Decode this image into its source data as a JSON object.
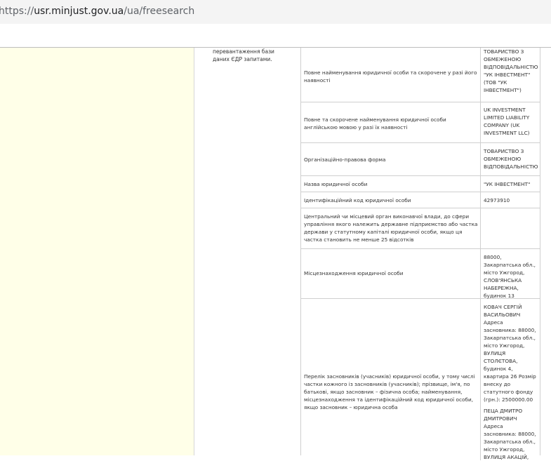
{
  "browser": {
    "url_scheme": "https://",
    "url_host": "usr.minjust.gov.ua",
    "url_path": "/ua/freesearch"
  },
  "note": {
    "text": "перевантаження бази даних ЄДР запитами."
  },
  "rows": [
    {
      "label": "Повне найменування юридичної особи та скорочене у разі його наявності",
      "value": "ТОВАРИСТВО З ОБМЕЖЕНОЮ ВІДПОВІДАЛЬНІСТЮ \"УК ІНВЕСТМЕНТ\" (ТОВ \"УК ІНВЕСТМЕНТ\")"
    },
    {
      "label": "Повне та скорочене найменування юридичної особи англійською мовою у разі їх наявності",
      "value": "UK INVESTMENT LIMITED LIABILITY COMPANY (UK INVESTMENT LLC)"
    },
    {
      "label": "Організаційно-правова форма",
      "value": "ТОВАРИСТВО З ОБМЕЖЕНОЮ ВІДПОВІДАЛЬНІСТЮ"
    },
    {
      "label": "Назва юридичної особи",
      "value": "\"УК ІНВЕСТМЕНТ\""
    },
    {
      "label": "Ідентифікаційний код юридичної особи",
      "value": "42973910"
    },
    {
      "label": "Центральний чи місцевий орган виконавчої влади, до сфери управління якого належить державне підприємство або частка держави у статутному капіталі юридичної особи, якщо ця частка становить не менше 25 відсотків",
      "value": ""
    },
    {
      "label": "Місцезнаходження юридичної особи",
      "value": "88000, Закарпатська обл., місто Ужгород, СЛОВ'ЯНСЬКА НАБЕРЕЖНА, будинок 13"
    },
    {
      "label": "Перелік засновників (учасників) юридичної особи, у тому числі частки кожного із засновників (учасників); прізвище, ім'я, по батькові, якщо засновник – фізична особа; найменування, місцезнаходження та ідентифікаційний код юридичної особи, якщо засновник – юридична особа",
      "value_founder1": "КОВАЧ СЕРГІЙ ВАСИЛЬОВИЧ Адреса засновника: 88000, Закарпатська обл., місто Ужгород, ВУЛИЦЯ СТОЛЄТОВА, будинок 4, квартира 26 Розмір внеску до статутного фонду (грн.): 2500000.00",
      "value_founder2": "ПЕЦА ДМИТРО ДМИТРОВИЧ Адреса засновника: 88000, Закарпатська обл., місто Ужгород, ВУЛИЦЯ АКАЦІЙ,"
    }
  ]
}
